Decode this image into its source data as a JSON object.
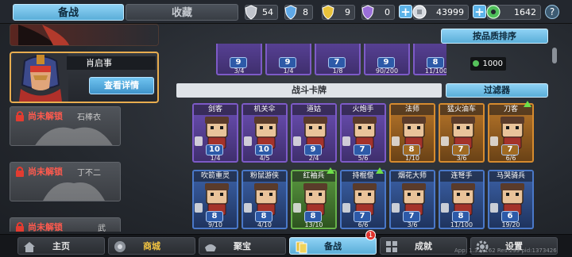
{
  "tabs": {
    "active": "备战",
    "inactive": "收藏"
  },
  "resources": [
    {
      "icon": "silver-shield-icon",
      "value": "54",
      "color": "#c0c4cc"
    },
    {
      "icon": "blue-shield-icon",
      "value": "8",
      "color": "#5fa8e6"
    },
    {
      "icon": "gold-shield-icon",
      "value": "9",
      "color": "#e8c23b"
    },
    {
      "icon": "purple-shield-icon",
      "value": "0",
      "color": "#9a6fd8"
    }
  ],
  "coins": {
    "value": "43999",
    "plus": "+"
  },
  "gems": {
    "value": "1642",
    "plus": "+"
  },
  "help": "?",
  "hero": {
    "name": "肖启事",
    "detail_button": "查看详情"
  },
  "locked_heroes": [
    {
      "label": "尚未解锁",
      "name": "石棒衣"
    },
    {
      "label": "尚未解锁",
      "name": "丁不二"
    },
    {
      "label": "尚未解锁",
      "name": "武"
    }
  ],
  "sort_button": "按品质排序",
  "top_row_counts": [
    {
      "level": "9",
      "fraction": "3/4"
    },
    {
      "level": "9",
      "fraction": "1/4"
    },
    {
      "level": "7",
      "fraction": "1/8"
    },
    {
      "level": "9",
      "fraction": "90/200"
    },
    {
      "level": "8",
      "fraction": "11/100"
    }
  ],
  "unlock_cost": "1000",
  "section_title": "战斗卡牌",
  "filter_button": "过滤器",
  "cards": [
    {
      "name": "剑客",
      "level": "10",
      "fraction": "1/4",
      "color": "purple",
      "upgrade": false
    },
    {
      "name": "机关伞",
      "level": "10",
      "fraction": "4/5",
      "color": "purple",
      "upgrade": false
    },
    {
      "name": "道姑",
      "level": "9",
      "fraction": "2/4",
      "color": "purple",
      "upgrade": false
    },
    {
      "name": "火炮手",
      "level": "7",
      "fraction": "5/6",
      "color": "purple",
      "upgrade": false
    },
    {
      "name": "法师",
      "level": "8",
      "fraction": "1/10",
      "color": "orange",
      "upgrade": false
    },
    {
      "name": "猛火油车",
      "level": "7",
      "fraction": "3/6",
      "color": "orange",
      "upgrade": false
    },
    {
      "name": "刀客",
      "level": "7",
      "fraction": "6/6",
      "color": "orange",
      "upgrade": true
    },
    {
      "name": "吹箭重灵",
      "level": "8",
      "fraction": "9/10",
      "color": "blue",
      "upgrade": false
    },
    {
      "name": "粉鼠游侠",
      "level": "8",
      "fraction": "4/10",
      "color": "blue",
      "upgrade": false
    },
    {
      "name": "红袖兵",
      "level": "8",
      "fraction": "13/10",
      "color": "green",
      "upgrade": true
    },
    {
      "name": "持棍僧",
      "level": "7",
      "fraction": "6/6",
      "color": "blue",
      "upgrade": true
    },
    {
      "name": "烟花大师",
      "level": "7",
      "fraction": "3/6",
      "color": "blue",
      "upgrade": false
    },
    {
      "name": "连弩手",
      "level": "8",
      "fraction": "11/100",
      "color": "blue",
      "upgrade": false
    },
    {
      "name": "马哭骑兵",
      "level": "6",
      "fraction": "19/20",
      "color": "blue",
      "upgrade": false
    }
  ],
  "nav": [
    {
      "label": "主页",
      "icon": "home-icon"
    },
    {
      "label": "商城",
      "icon": "shop-icon"
    },
    {
      "label": "聚宝",
      "icon": "treasure-icon"
    },
    {
      "label": "备战",
      "icon": "cards-icon"
    },
    {
      "label": "成就",
      "icon": "achievement-icon"
    },
    {
      "label": "设置",
      "icon": "gear-icon"
    }
  ],
  "nav_badge": "1",
  "version": "App: 1.3.0.162 Res:233 pid:1373426"
}
